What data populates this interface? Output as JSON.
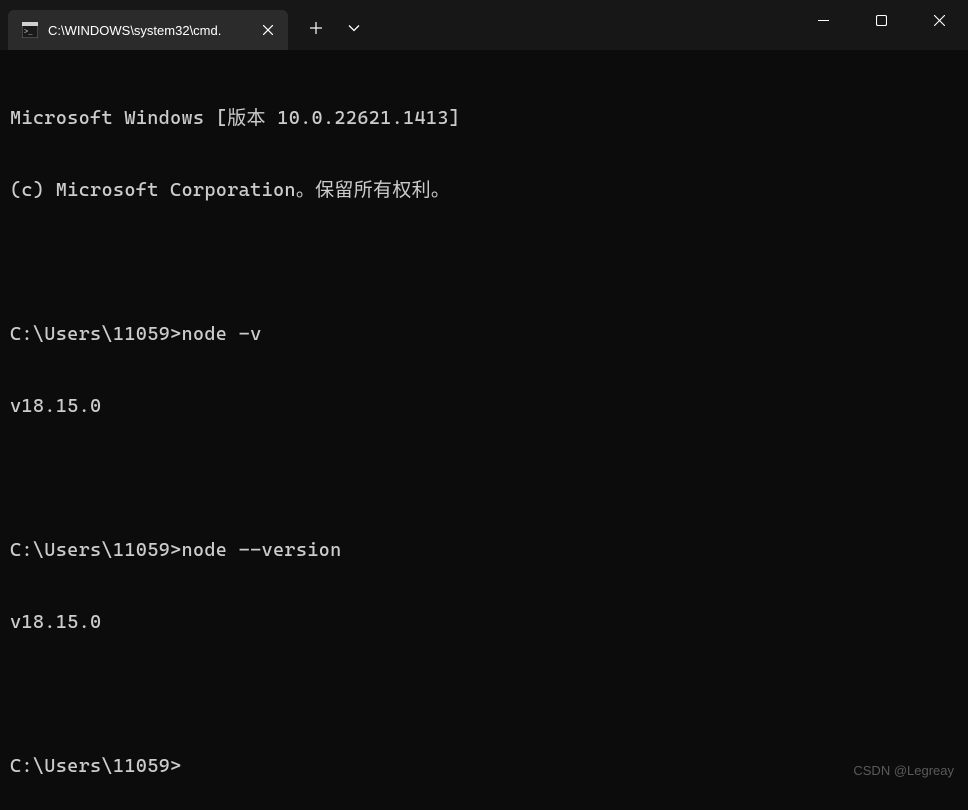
{
  "window": {
    "tab_title": "C:\\WINDOWS\\system32\\cmd."
  },
  "terminal": {
    "lines": [
      "Microsoft Windows [版本 10.0.22621.1413]",
      "(c) Microsoft Corporation。保留所有权利。",
      "",
      "C:\\Users\\11059>node -v",
      "v18.15.0",
      "",
      "C:\\Users\\11059>node --version",
      "v18.15.0",
      "",
      "C:\\Users\\11059>"
    ]
  },
  "watermark": "CSDN @Legreay"
}
